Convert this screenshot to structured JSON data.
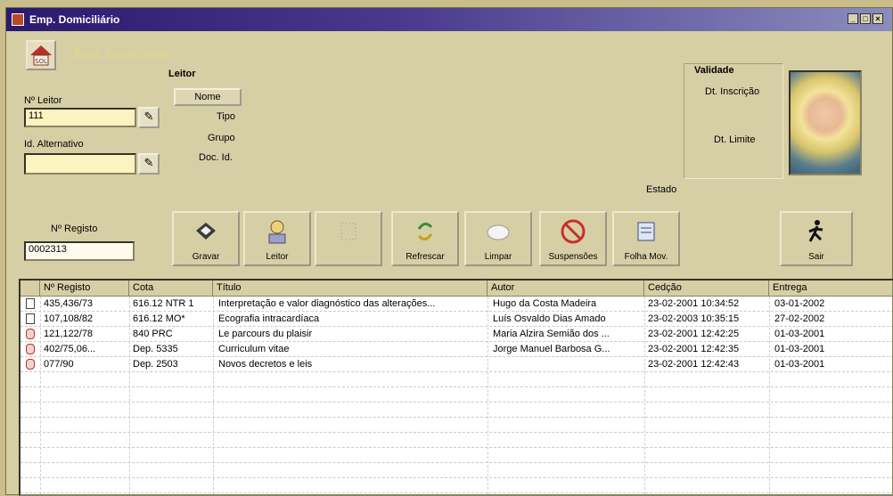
{
  "window": {
    "title": "Emp. Domiciliário"
  },
  "header": {
    "subtitle": "Emp. Domiciliário"
  },
  "leitor": {
    "section_label": "Leitor",
    "n_leitor_label": "Nº Leitor",
    "n_leitor_value": "111",
    "id_alternativo_label": "Id. Alternativo",
    "id_alternativo_value": "",
    "nome_button": "Nome",
    "tipo_label": "Tipo",
    "grupo_label": "Grupo",
    "doc_id_label": "Doc. Id."
  },
  "validade": {
    "section_label": "Validade",
    "dt_inscricao_label": "Dt. Inscrição",
    "dt_limite_label": "Dt. Limite",
    "estado_label": "Estado"
  },
  "registo": {
    "label": "Nº Registo",
    "value": "0002313"
  },
  "toolbar": {
    "buttons": [
      {
        "label": "Gravar",
        "icon": "save-disk-icon"
      },
      {
        "label": "Leitor",
        "icon": "reader-person-icon"
      },
      {
        "label": "",
        "icon": "disabled-action-icon"
      },
      {
        "label": "Refrescar",
        "icon": "refresh-arrows-icon"
      },
      {
        "label": "Limpar",
        "icon": "eraser-icon"
      },
      {
        "label": "Suspensões",
        "icon": "no-entry-icon"
      },
      {
        "label": "Folha Mov.",
        "icon": "movement-sheet-icon"
      }
    ],
    "exit_label": "Sair"
  },
  "table": {
    "columns": [
      "Nº Registo",
      "Cota",
      "Título",
      "Autor",
      "Cedção",
      "Entrega"
    ],
    "rows": [
      {
        "icon": "document",
        "registo": "435,436/73",
        "cota": "616.12 NTR 1",
        "titulo": "Interpretação e valor diagnóstico das alterações...",
        "autor": "Hugo da Costa Madeira",
        "cedencia": "23-02-2001 10:34:52",
        "entrega": "03-01-2002"
      },
      {
        "icon": "document",
        "registo": "107,108/82",
        "cota": "616.12 MO*",
        "titulo": "Ecografia intracardíaca",
        "autor": "Luís Osvaldo Dias Amado",
        "cedencia": "23-02-2003 10:35:15",
        "entrega": "27-02-2002"
      },
      {
        "icon": "book-red",
        "registo": "121,122/78",
        "cota": "840 PRC",
        "titulo": "Le parcours du plaisir",
        "autor": "Maria Alzira Semião dos ...",
        "cedencia": "23-02-2001 12:42:25",
        "entrega": "01-03-2001"
      },
      {
        "icon": "book-red",
        "registo": "402/75,06...",
        "cota": "Dep. 5335",
        "titulo": "Curriculum vitae",
        "autor": "Jorge Manuel Barbosa G...",
        "cedencia": "23-02-2001 12:42:35",
        "entrega": "01-03-2001"
      },
      {
        "icon": "book-red",
        "registo": "077/90",
        "cota": "Dep. 2503",
        "titulo": "Novos decretos e leis",
        "autor": "",
        "cedencia": "23-02-2001 12:42:43",
        "entrega": "01-03-2001"
      }
    ]
  }
}
